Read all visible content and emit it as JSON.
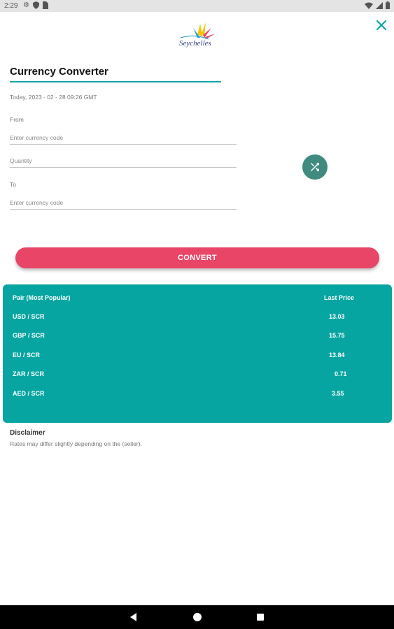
{
  "status_bar": {
    "time": "2:29",
    "left_icons": [
      "gear-icon",
      "shield-icon",
      "sim-icon"
    ],
    "right_icons": [
      "wifi-icon",
      "signal-icon",
      "battery-icon"
    ]
  },
  "header": {
    "logo_text": "Seychelles",
    "close_icon": "close-icon"
  },
  "title": "Currency Converter",
  "date_text": "Today, 2023 - 02 - 28 09:26 GMT",
  "form": {
    "from_label": "From",
    "from_placeholder": "Enter currency code",
    "from_value": "",
    "quantity_placeholder": "Quantity",
    "quantity_value": "",
    "to_label": "To",
    "to_placeholder": "Enter currency code",
    "to_value": ""
  },
  "swap_icon": "shuffle-icon",
  "convert_label": "CONVERT",
  "rates": {
    "header_pair": "Pair (Most Popular)",
    "header_price": "Last Price",
    "rows": [
      {
        "pair": "USD / SCR",
        "price": "13.03"
      },
      {
        "pair": "GBP / SCR",
        "price": "15.75"
      },
      {
        "pair": "EU / SCR",
        "price": "13.84"
      },
      {
        "pair": "ZAR / SCR",
        "price": "0.71"
      },
      {
        "pair": "AED / SCR",
        "price": "3.55"
      }
    ]
  },
  "disclaimer": {
    "title": "Disclaimer",
    "text": "Rates may differ slightly depending on the (seller)."
  },
  "navbar": {
    "back_icon": "back-icon",
    "home_icon": "home-icon",
    "recents_icon": "recents-icon"
  },
  "colors": {
    "accent_teal": "#07a5a1",
    "convert_pink": "#e84567",
    "swap_green": "#3f8b7f"
  }
}
